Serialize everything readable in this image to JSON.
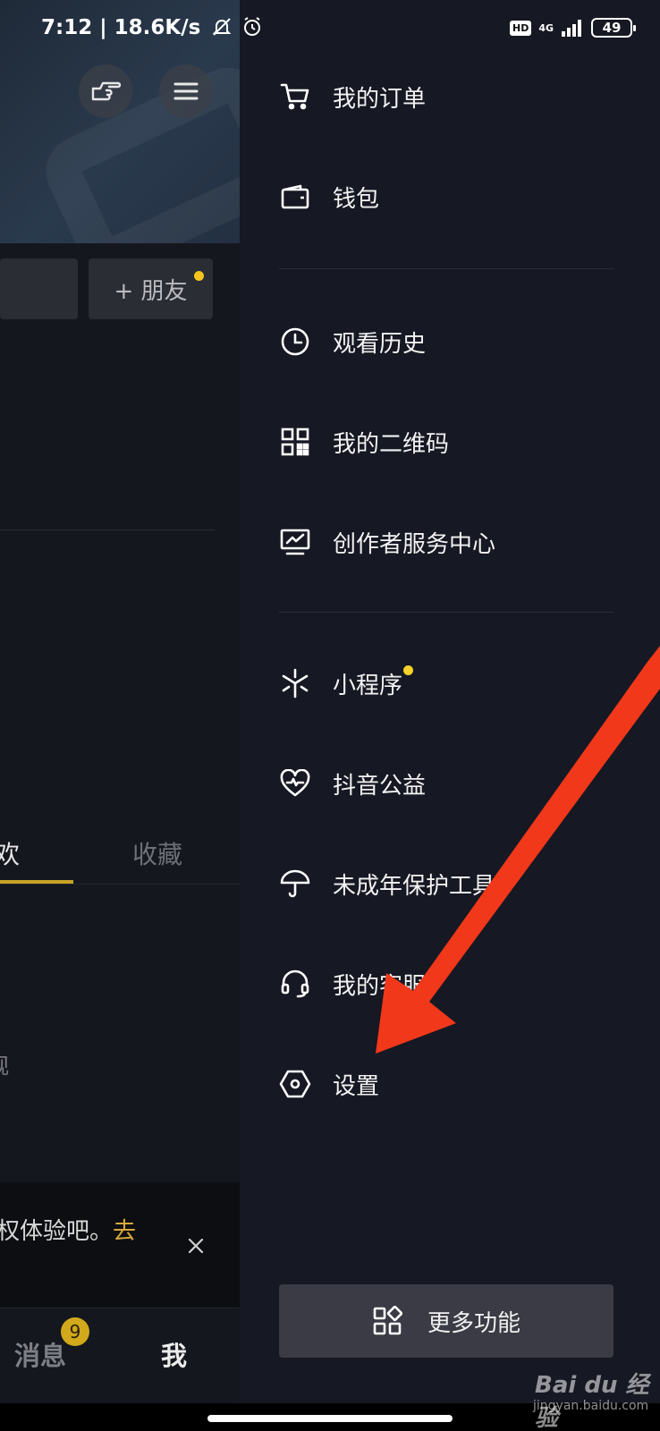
{
  "status_bar": {
    "time": "7:12 | 18.6K/s",
    "hd": "HD",
    "network": "4G",
    "battery": "49"
  },
  "left_page": {
    "add_friend_label": "+ 朋友",
    "tab_likes_fragment": "欢",
    "tab_favorites": "收藏",
    "view_fragment": "观",
    "promo_text": "权体验吧。",
    "promo_link": "去",
    "nav_messages": "消息",
    "nav_messages_badge": "9",
    "nav_me": "我"
  },
  "drawer": {
    "items": [
      {
        "label": "我的订单",
        "icon": "cart-icon"
      },
      {
        "label": "钱包",
        "icon": "wallet-icon"
      },
      {
        "label": "观看历史",
        "icon": "clock-icon"
      },
      {
        "label": "我的二维码",
        "icon": "qrcode-icon"
      },
      {
        "label": "创作者服务中心",
        "icon": "monitor-chart-icon"
      },
      {
        "label": "小程序",
        "icon": "mini-program-icon",
        "dot": true
      },
      {
        "label": "抖音公益",
        "icon": "heart-wave-icon"
      },
      {
        "label": "未成年保护工具",
        "icon": "umbrella-icon"
      },
      {
        "label": "我的客服",
        "icon": "headset-icon"
      },
      {
        "label": "设置",
        "icon": "settings-hexagon-icon"
      }
    ],
    "more_button": "更多功能"
  },
  "watermark": {
    "brand": "Bai du 经验",
    "url": "jingyan.baidu.com"
  },
  "colors": {
    "drawer_bg": "#161823",
    "accent_yellow": "#f6d12a",
    "arrow_red": "#f2381a"
  }
}
